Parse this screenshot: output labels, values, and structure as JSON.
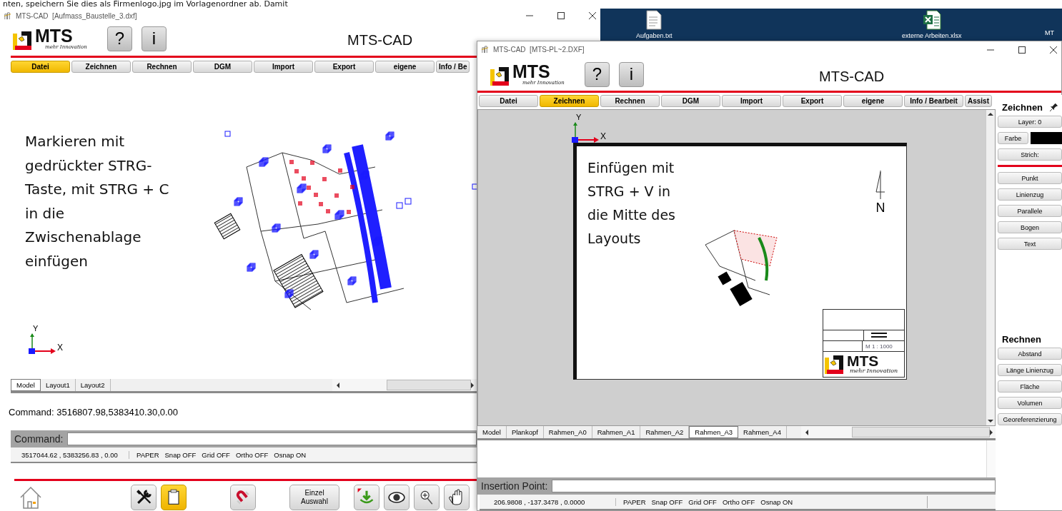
{
  "document_text": "nten, speichern Sie dies als Firmenlogo.jpg im Vorlagenordner ab. Damit",
  "desktop_icons": [
    {
      "kind": "text",
      "label": "Aufgaben.txt"
    },
    {
      "kind": "excel",
      "label": "externe Arbeiten.xlsx"
    },
    {
      "kind": "file",
      "label": "MT"
    }
  ],
  "windows": [
    {
      "title": "MTS-CAD  [Aufmass_Baustelle_3.dxf]",
      "heading": "MTS-CAD",
      "logo": {
        "name": "MTS",
        "tagline": "mehr Innovation"
      },
      "header_buttons": [
        "?",
        "i"
      ],
      "menu": [
        {
          "label": "Datei",
          "selected": true
        },
        {
          "label": "Zeichnen",
          "selected": false
        },
        {
          "label": "Rechnen",
          "selected": false
        },
        {
          "label": "DGM",
          "selected": false
        },
        {
          "label": "Import",
          "selected": false
        },
        {
          "label": "Export",
          "selected": false
        },
        {
          "label": "eigene",
          "selected": false
        },
        {
          "label": "Info / Be",
          "selected": false
        }
      ],
      "canvas": {
        "kind": "model",
        "annotation": "Markieren mit\ngedrückter STRG-\nTaste, mit STRG + C\nin die\nZwischenablage\neinfügen",
        "axis": {
          "y": "Y",
          "x": "X"
        }
      },
      "layout_tabs": [
        {
          "label": "Model",
          "selected": true
        },
        {
          "label": "Layout1",
          "selected": false
        },
        {
          "label": "Layout2",
          "selected": false
        }
      ],
      "output": "Command: 3516807.98,5383410.30,0.00",
      "prompt_label": "Command:",
      "status": {
        "coords": "3517044.62 , 5383256.83 , 0.00",
        "flags": [
          "PAPER",
          "Snap OFF",
          "Grid OFF",
          "Ortho OFF",
          "Osnap ON"
        ]
      },
      "toolbar": [
        {
          "kind": "home",
          "selected": false
        },
        {
          "kind": "tools",
          "selected": false
        },
        {
          "kind": "clipboard",
          "selected": true
        },
        {
          "kind": "magnet",
          "selected": false
        },
        {
          "kind": "text",
          "label": "Einzel\nAuswahl",
          "selected": false
        },
        {
          "kind": "download",
          "selected": false
        },
        {
          "kind": "eye",
          "selected": false
        },
        {
          "kind": "zoom",
          "selected": false
        },
        {
          "kind": "hand",
          "selected": false
        }
      ]
    },
    {
      "title": "MTS-CAD  [MTS-PL~2.DXF]",
      "heading": "MTS-CAD",
      "logo": {
        "name": "MTS",
        "tagline": "mehr Innovation"
      },
      "header_buttons": [
        "?",
        "i"
      ],
      "menu": [
        {
          "label": "Datei",
          "selected": false
        },
        {
          "label": "Zeichnen",
          "selected": true
        },
        {
          "label": "Rechnen",
          "selected": false
        },
        {
          "label": "DGM",
          "selected": false
        },
        {
          "label": "Import",
          "selected": false
        },
        {
          "label": "Export",
          "selected": false
        },
        {
          "label": "eigene",
          "selected": false
        },
        {
          "label": "Info / Bearbeit",
          "selected": false
        },
        {
          "label": "Assist",
          "selected": false
        }
      ],
      "canvas": {
        "kind": "sheet",
        "annotation": "Einfügen  mit\nSTRG + V in\ndie Mitte des\nLayouts",
        "axis": {
          "y": "Y",
          "x": "X"
        },
        "compass": "N",
        "scale": "M 1 : 1000",
        "logo": {
          "name": "MTS",
          "tagline": "mehr Innovation"
        }
      },
      "layout_tabs": [
        {
          "label": "Model",
          "selected": false
        },
        {
          "label": "Plankopf",
          "selected": false
        },
        {
          "label": "Rahmen_A0",
          "selected": false
        },
        {
          "label": "Rahmen_A1",
          "selected": false
        },
        {
          "label": "Rahmen_A2",
          "selected": false
        },
        {
          "label": "Rahmen_A3",
          "selected": true
        },
        {
          "label": "Rahmen_A4",
          "selected": false
        }
      ],
      "prompt_label": "Insertion Point:",
      "status": {
        "coords": "206.9808 , -137.3478 , 0.0000",
        "flags": [
          "PAPER",
          "Snap OFF",
          "Grid OFF",
          "Ortho OFF",
          "Osnap ON"
        ]
      },
      "side_panel": [
        {
          "heading": "Zeichnen",
          "pin": true,
          "items": [
            {
              "kind": "button",
              "label": "Layer: 0"
            },
            {
              "kind": "color",
              "label": "Farbe",
              "color": "#000000"
            },
            {
              "kind": "button",
              "label": "Strich:"
            },
            {
              "kind": "separator"
            },
            {
              "kind": "button",
              "label": "Punkt"
            },
            {
              "kind": "button",
              "label": "Linienzug"
            },
            {
              "kind": "button",
              "label": "Parallele"
            },
            {
              "kind": "button",
              "label": "Bogen"
            },
            {
              "kind": "button",
              "label": "Text"
            }
          ]
        },
        {
          "heading": "Rechnen",
          "pin": false,
          "items": [
            {
              "kind": "button",
              "label": "Abstand"
            },
            {
              "kind": "button",
              "label": "Länge Linienzug"
            },
            {
              "kind": "button",
              "label": "Fläche"
            },
            {
              "kind": "button",
              "label": "Volumen"
            },
            {
              "kind": "button",
              "label": "Georeferenzierung"
            }
          ]
        }
      ]
    }
  ]
}
